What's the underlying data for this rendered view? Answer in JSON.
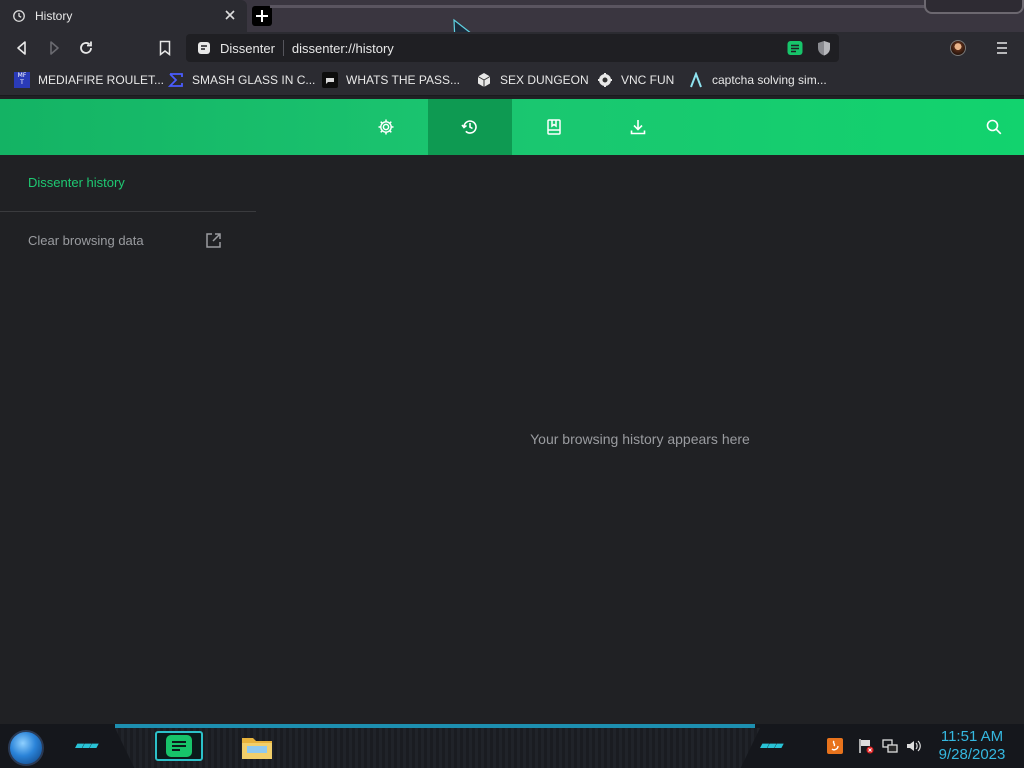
{
  "tab": {
    "title": "History"
  },
  "omnibox": {
    "site_label": "Dissenter",
    "url": "dissenter://history"
  },
  "bookmarks": [
    {
      "label": "MEDIAFIRE ROULET...",
      "icon": "mediafire-icon"
    },
    {
      "label": "SMASH GLASS IN C...",
      "icon": "sigma-icon"
    },
    {
      "label": "WHATS THE PASS...",
      "icon": "chat-icon"
    },
    {
      "label": "SEX DUNGEON",
      "icon": "cube-icon"
    },
    {
      "label": "VNC FUN",
      "icon": "gear-globe-icon"
    },
    {
      "label": "captcha solving sim...",
      "icon": "lambda-icon"
    }
  ],
  "sidebar": {
    "title": "Dissenter history",
    "clear": "Clear browsing data"
  },
  "main": {
    "empty_message": "Your browsing history appears here"
  },
  "clock": {
    "time": "11:51 AM",
    "date": "9/28/2023"
  },
  "colors": {
    "accent": "#1ec872",
    "header": "#14b364",
    "active_tab": "#0e9a52",
    "background": "#202124"
  }
}
